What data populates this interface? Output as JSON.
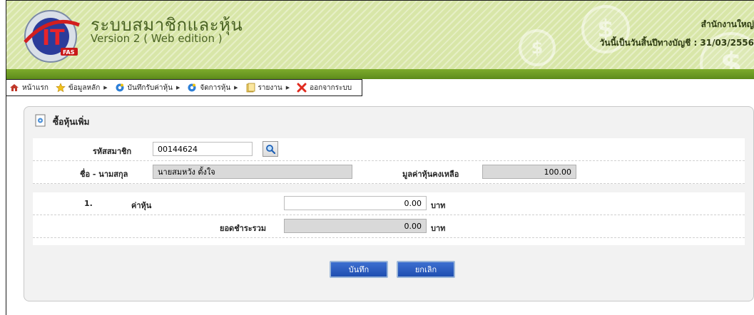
{
  "header": {
    "app_title": "ระบบสมาชิกและหุ้น",
    "app_subtitle": "Version 2 ( Web edition )",
    "logo_text": "IT",
    "logo_badge": "FAS",
    "coin_symbol": "$",
    "office_name": "สำนักงานใหญ่",
    "fiscal_date_label": "วันนี้เป็นวันสิ้นปีทางบัญชี : 31/03/2556"
  },
  "menu": {
    "items": [
      {
        "label": "หน้าแรก",
        "icon": "home-icon",
        "has_submenu": false
      },
      {
        "label": "ข้อมูลหลัก",
        "icon": "star-icon",
        "has_submenu": true
      },
      {
        "label": "บันทึกรับค่าหุ้น",
        "icon": "gear-icon",
        "has_submenu": true
      },
      {
        "label": "จัดการหุ้น",
        "icon": "gear-icon",
        "has_submenu": true
      },
      {
        "label": "รายงาน",
        "icon": "report-icon",
        "has_submenu": true
      },
      {
        "label": "ออกจากระบบ",
        "icon": "close-icon",
        "has_submenu": false
      }
    ]
  },
  "panel": {
    "title": "ซื้อหุ้นเพิ่ม",
    "member_id_label": "รหัสสมาชิก",
    "member_id_value": "00144624",
    "name_label": "ชื่อ - นามสกุล",
    "name_value": "นายสมหวัง ตั้งใจ",
    "remaining_label": "มูลค่าหุ้นคงเหลือ",
    "remaining_value": "100.00",
    "item_no": "1.",
    "share_label": "ค่าหุ้น",
    "share_value": "0.00",
    "unit": "บาท",
    "total_label": "ยอดชำระรวม",
    "total_value": "0.00",
    "save_label": "บันทึก",
    "cancel_label": "ยกเลิก"
  },
  "colors": {
    "header_bg": "#d8e6a8",
    "header_strip": "#6a9a22",
    "title_text": "#4a6324",
    "button_blue": "#2a5bc0"
  }
}
